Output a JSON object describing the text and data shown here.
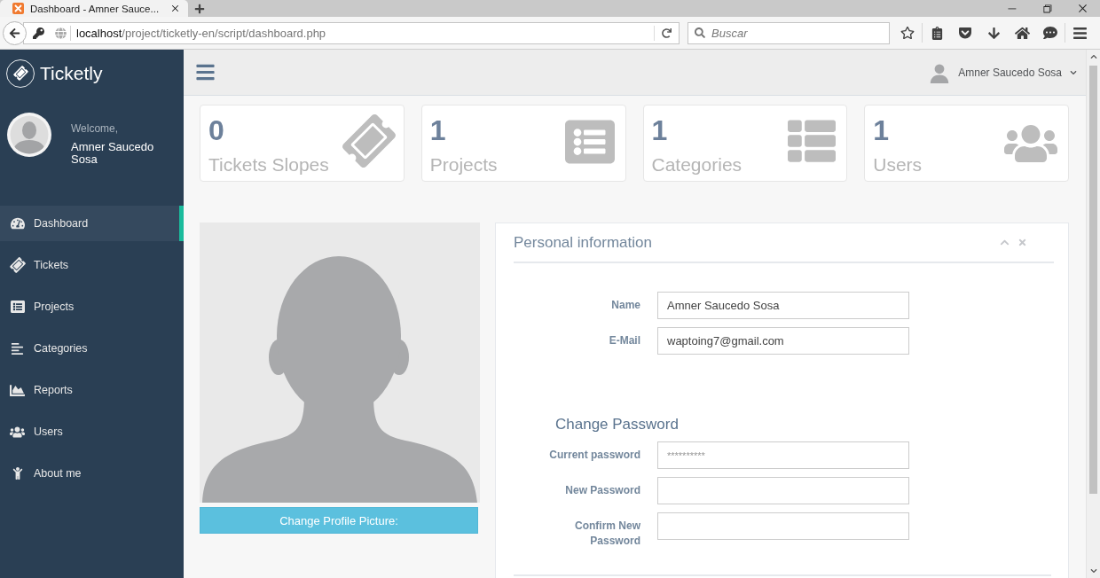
{
  "browser": {
    "tab_title": "Dashboard - Amner Sauce...",
    "address": {
      "host": "localhost",
      "path": "/project/ticketly-en/script/dashboard.php"
    },
    "search": {
      "placeholder": "Buscar"
    }
  },
  "sidebar": {
    "brand": "Ticketly",
    "welcome": "Welcome,",
    "user_name": "Amner Saucedo Sosa",
    "items": [
      {
        "label": "Dashboard",
        "selected": true
      },
      {
        "label": "Tickets",
        "selected": false
      },
      {
        "label": "Projects",
        "selected": false
      },
      {
        "label": "Categories",
        "selected": false
      },
      {
        "label": "Reports",
        "selected": false
      },
      {
        "label": "Users",
        "selected": false
      },
      {
        "label": "About me",
        "selected": false
      }
    ]
  },
  "topbar": {
    "user_name": "Amner Saucedo Sosa"
  },
  "stats": [
    {
      "value": "0",
      "label": "Tickets Slopes"
    },
    {
      "value": "1",
      "label": "Projects"
    },
    {
      "value": "1",
      "label": "Categories"
    },
    {
      "value": "1",
      "label": "Users"
    }
  ],
  "profile_picture": {
    "button": "Change Profile Picture:"
  },
  "personal_info": {
    "title": "Personal information",
    "fields": [
      {
        "label": "Name",
        "value": "Amner Saucedo Sosa"
      },
      {
        "label": "E-Mail",
        "value": "waptoing7@gmail.com"
      }
    ],
    "password": {
      "title": "Change Password",
      "fields": [
        {
          "label": "Current password",
          "placeholder": "**********"
        },
        {
          "label": "New Password"
        },
        {
          "label": "Confirm New Password"
        }
      ]
    }
  }
}
